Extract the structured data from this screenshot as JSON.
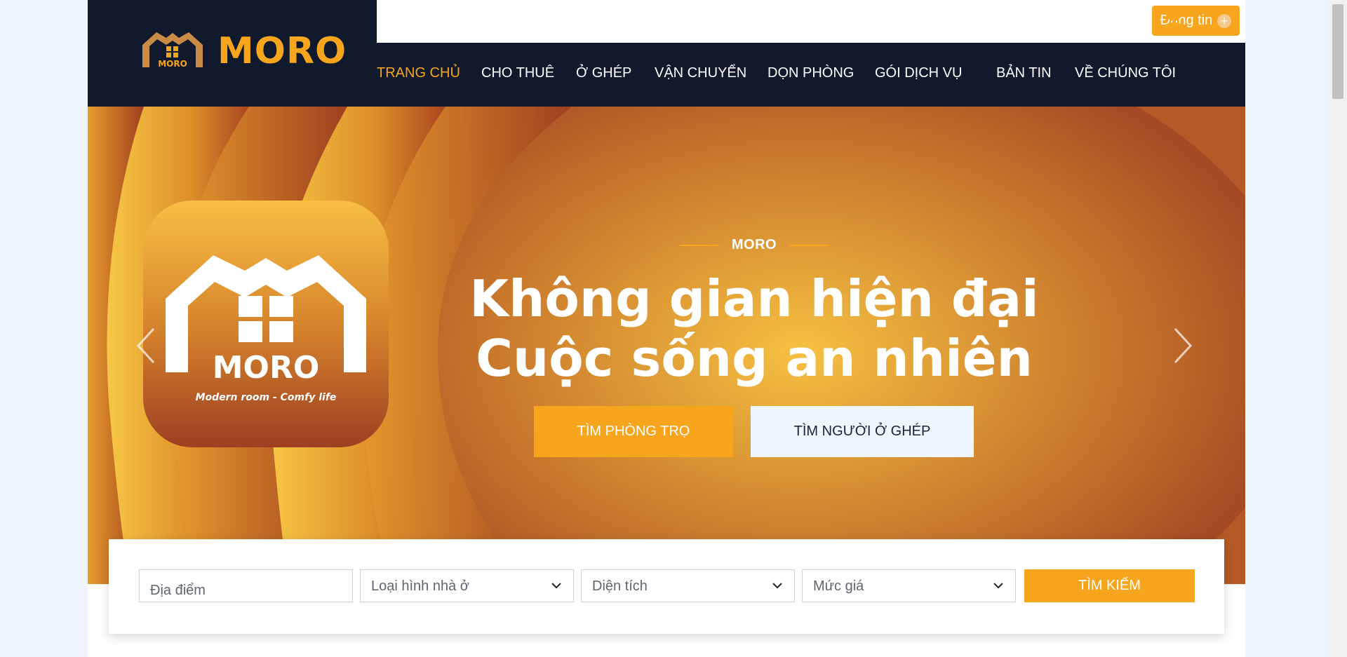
{
  "brand": {
    "name": "MORO",
    "logo_tag": "MORO",
    "tagline": "Modern room - Comfy life"
  },
  "header": {
    "post_button": "Đăng tin",
    "user_icon": "user-icon"
  },
  "nav": {
    "items": [
      "TRANG CHỦ",
      "CHO THUÊ",
      "Ở GHÉP",
      "VẬN CHUYỂN",
      "DỌN PHÒNG",
      "GÓI DỊCH VỤ",
      "BẢN TIN",
      "VỀ CHÚNG TÔI"
    ],
    "active_index": 0
  },
  "hero": {
    "eyebrow": "MORO",
    "headline_line1": "Không gian hiện đại",
    "headline_line2": "Cuộc sống an nhiên",
    "primary_button": "TÌM PHÒNG TRỌ",
    "secondary_button": "TÌM NGƯỜI Ở GHÉP"
  },
  "search": {
    "location_placeholder": "Địa điểm",
    "type_select": "Loại hình nhà ở",
    "area_select": "Diện tích",
    "price_select": "Mức giá",
    "submit": "TÌM KIẾM"
  },
  "colors": {
    "accent": "#f7a51c",
    "navy": "#111a2d",
    "hero_dark": "#9a3d22"
  }
}
